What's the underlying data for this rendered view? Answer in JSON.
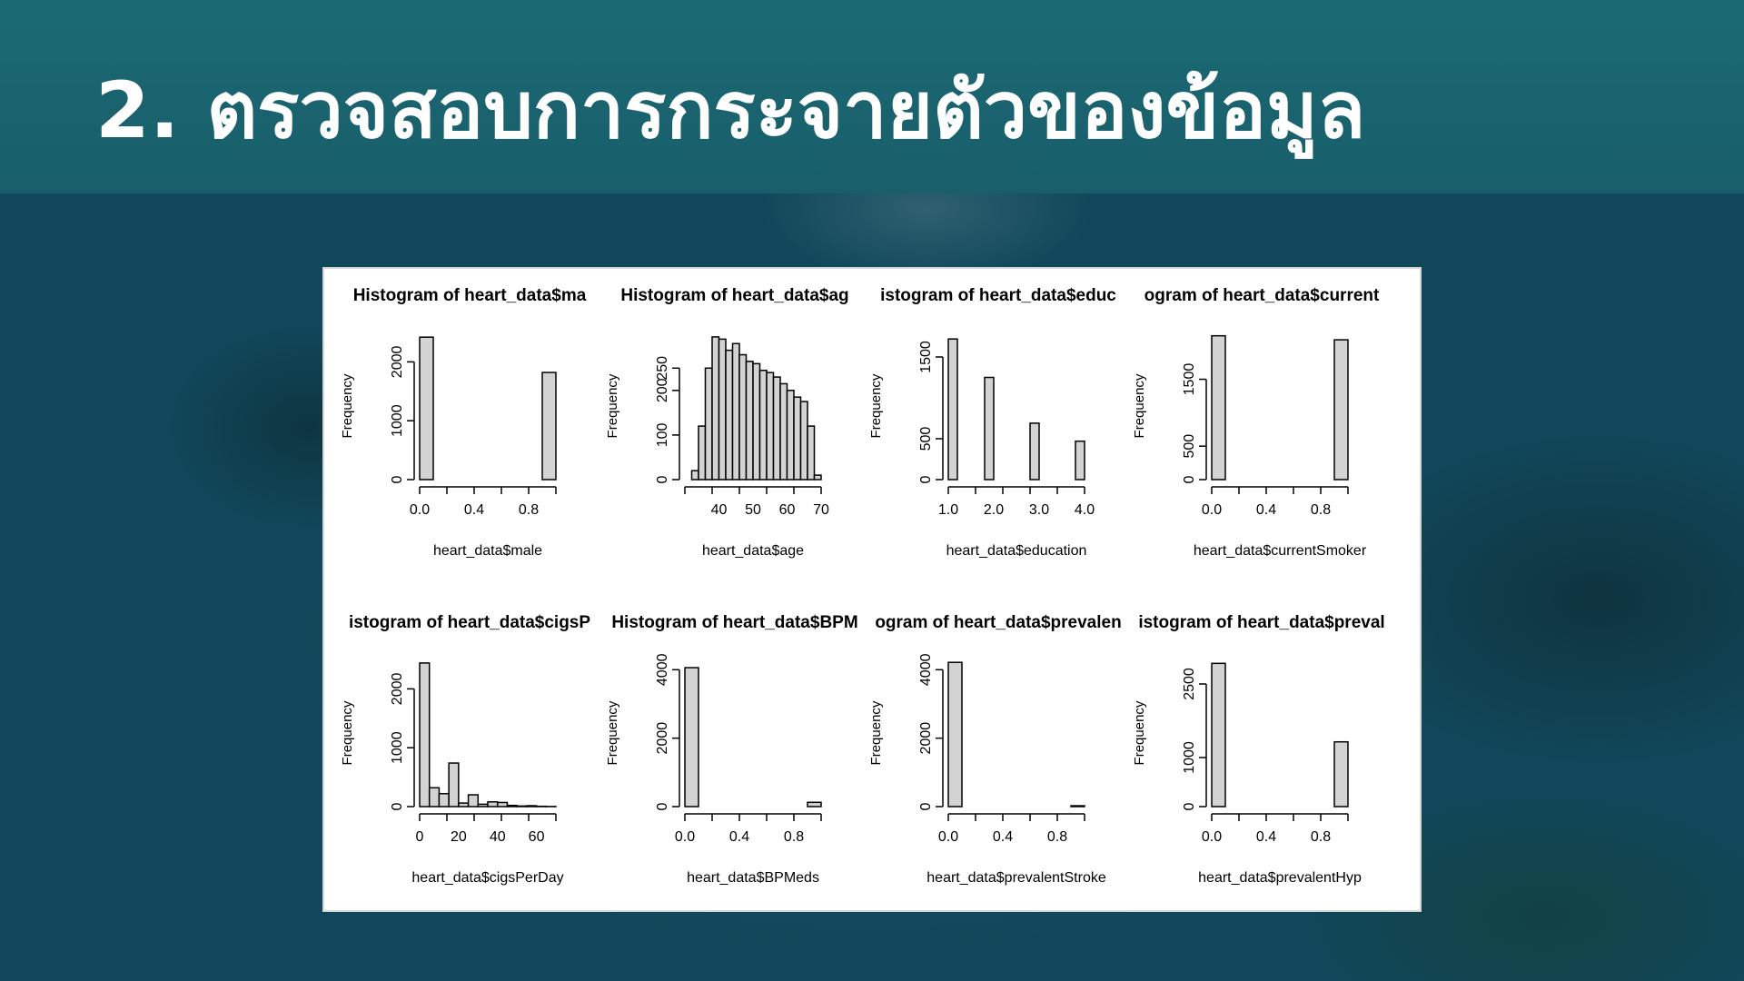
{
  "slide": {
    "title": "2. ตรวจสอบการกระจายตัวของข้อมูล"
  },
  "colors": {
    "bar_fill": "#d3d3d3",
    "bar_stroke": "#000000",
    "title_text": "#ffffff",
    "background": "#13505e"
  },
  "chart_data": [
    {
      "type": "bar",
      "title": "Histogram of heart_data$ma",
      "xlabel": "heart_data$male",
      "ylabel": "Frequency",
      "x_ticks": [
        "0.0",
        "0.4",
        "0.8"
      ],
      "y_ticks": [
        "0",
        "1000",
        "2000"
      ],
      "xlim": [
        0,
        1
      ],
      "ylim": [
        0,
        2500
      ],
      "bins": [
        [
          0.0,
          0.1,
          2420
        ],
        [
          0.9,
          1.0,
          1820
        ]
      ]
    },
    {
      "type": "bar",
      "title": "Histogram of heart_data$ag",
      "xlabel": "heart_data$age",
      "ylabel": "Frequency",
      "x_ticks": [
        "40",
        "50",
        "60",
        "70"
      ],
      "y_ticks": [
        "0",
        "100",
        "200",
        "250"
      ],
      "xlim": [
        30,
        70
      ],
      "ylim": [
        0,
        330
      ],
      "bins": [
        [
          32,
          34,
          20
        ],
        [
          34,
          36,
          120
        ],
        [
          36,
          38,
          250
        ],
        [
          38,
          40,
          320
        ],
        [
          40,
          42,
          315
        ],
        [
          42,
          44,
          290
        ],
        [
          44,
          46,
          305
        ],
        [
          46,
          48,
          280
        ],
        [
          48,
          50,
          265
        ],
        [
          50,
          52,
          260
        ],
        [
          52,
          54,
          245
        ],
        [
          54,
          56,
          240
        ],
        [
          56,
          58,
          230
        ],
        [
          58,
          60,
          215
        ],
        [
          60,
          62,
          200
        ],
        [
          62,
          64,
          185
        ],
        [
          64,
          66,
          175
        ],
        [
          66,
          68,
          120
        ],
        [
          68,
          70,
          10
        ]
      ]
    },
    {
      "type": "bar",
      "title": "Histogram of heart_data$educ",
      "xlabel": "heart_data$education",
      "ylabel": "Frequency",
      "x_ticks": [
        "1.0",
        "2.0",
        "3.0",
        "4.0"
      ],
      "y_ticks": [
        "0",
        "500",
        "1500"
      ],
      "xlim": [
        1,
        4
      ],
      "ylim": [
        0,
        1800
      ],
      "bins": [
        [
          1.0,
          1.2,
          1720
        ],
        [
          1.8,
          2.0,
          1250
        ],
        [
          2.8,
          3.0,
          690
        ],
        [
          3.8,
          4.0,
          470
        ]
      ]
    },
    {
      "type": "bar",
      "title": "Histogram of heart_data$current",
      "xlabel": "heart_data$currentSmoker",
      "ylabel": "Frequency",
      "x_ticks": [
        "0.0",
        "0.4",
        "0.8"
      ],
      "y_ticks": [
        "0",
        "500",
        "1500"
      ],
      "xlim": [
        0,
        1
      ],
      "ylim": [
        0,
        2200
      ],
      "bins": [
        [
          0.0,
          0.1,
          2150
        ],
        [
          0.9,
          1.0,
          2090
        ]
      ]
    },
    {
      "type": "bar",
      "title": "Histogram of heart_data$cigsP",
      "xlabel": "heart_data$cigsPerDay",
      "ylabel": "Frequency",
      "x_ticks": [
        "0",
        "20",
        "40",
        "60"
      ],
      "y_ticks": [
        "0",
        "1000",
        "2000"
      ],
      "xlim": [
        0,
        70
      ],
      "ylim": [
        0,
        2500
      ],
      "bins": [
        [
          0,
          5,
          2440
        ],
        [
          5,
          10,
          320
        ],
        [
          10,
          15,
          220
        ],
        [
          15,
          20,
          740
        ],
        [
          20,
          25,
          60
        ],
        [
          25,
          30,
          200
        ],
        [
          30,
          35,
          40
        ],
        [
          35,
          40,
          80
        ],
        [
          40,
          45,
          70
        ],
        [
          45,
          50,
          20
        ],
        [
          50,
          55,
          10
        ],
        [
          55,
          60,
          15
        ],
        [
          60,
          65,
          5
        ],
        [
          65,
          70,
          2
        ]
      ]
    },
    {
      "type": "bar",
      "title": "Histogram of heart_data$BPM",
      "xlabel": "heart_data$BPMeds",
      "ylabel": "Frequency",
      "x_ticks": [
        "0.0",
        "0.4",
        "0.8"
      ],
      "y_ticks": [
        "0",
        "2000",
        "4000"
      ],
      "xlim": [
        0,
        1
      ],
      "ylim": [
        0,
        4300
      ],
      "bins": [
        [
          0.0,
          0.1,
          4060
        ],
        [
          0.9,
          1.0,
          125
        ]
      ]
    },
    {
      "type": "bar",
      "title": "Histogram of heart_data$prevalentStroke",
      "xlabel": "heart_data$prevalentStroke",
      "ylabel": "Frequency",
      "x_ticks": [
        "0.0",
        "0.4",
        "0.8"
      ],
      "y_ticks": [
        "0",
        "2000",
        "4000"
      ],
      "xlim": [
        0,
        1
      ],
      "ylim": [
        0,
        4300
      ],
      "bins": [
        [
          0.0,
          0.1,
          4215
        ],
        [
          0.9,
          1.0,
          25
        ]
      ]
    },
    {
      "type": "bar",
      "title": "Histogram of heart_data$prevalentHyp",
      "xlabel": "heart_data$prevalentHyp",
      "ylabel": "Frequency",
      "x_ticks": [
        "0.0",
        "0.4",
        "0.8"
      ],
      "y_ticks": [
        "0",
        "1000",
        "2500"
      ],
      "xlim": [
        0,
        1
      ],
      "ylim": [
        0,
        3000
      ],
      "bins": [
        [
          0.0,
          0.1,
          2920
        ],
        [
          0.9,
          1.0,
          1320
        ]
      ]
    }
  ],
  "panel_titles_display": [
    "Histogram of heart_data$ma",
    "Histogram of heart_data$ag",
    "istogram of heart_data$educ",
    "ogram of heart_data$current",
    "istogram of heart_data$cigsP",
    "Histogram of heart_data$BPM",
    "ogram of heart_data$prevalen",
    "istogram of heart_data$preval"
  ]
}
